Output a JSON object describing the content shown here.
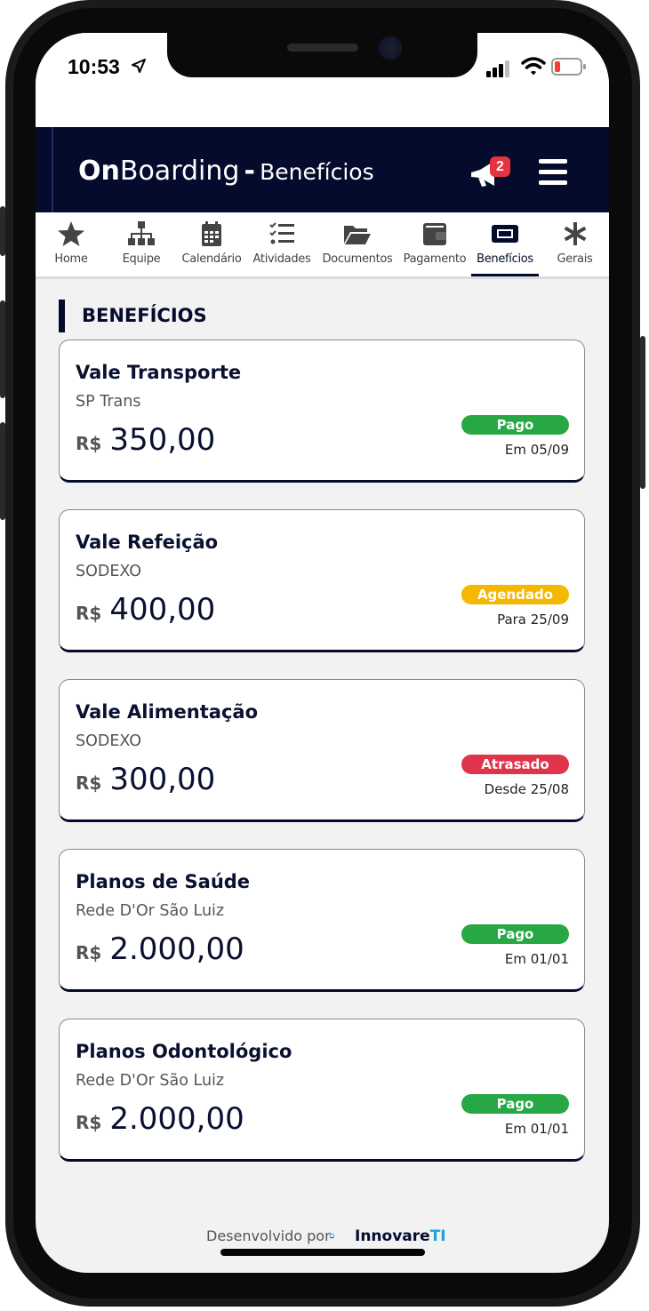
{
  "status_bar": {
    "time": "10:53"
  },
  "header": {
    "brand_bold": "On",
    "brand_rest": "Boarding",
    "separator": "-",
    "page": "Benefícios",
    "notification_count": "2"
  },
  "tabs": [
    {
      "label": "Home",
      "icon": "star-icon"
    },
    {
      "label": "Equipe",
      "icon": "sitemap-icon"
    },
    {
      "label": "Calendário",
      "icon": "calendar-icon"
    },
    {
      "label": "Atividades",
      "icon": "tasks-icon"
    },
    {
      "label": "Documentos",
      "icon": "folder-open-icon"
    },
    {
      "label": "Pagamento",
      "icon": "wallet-icon"
    },
    {
      "label": "Benefícios",
      "icon": "ticket-icon",
      "active": true
    },
    {
      "label": "Gerais",
      "icon": "asterisk-icon"
    }
  ],
  "section": {
    "title": "BENEFÍCIOS"
  },
  "benefits": [
    {
      "name": "Vale Transporte",
      "provider": "SP Trans",
      "currency": "R$",
      "amount": "350,00",
      "status": "Pago",
      "status_color": "#28a745",
      "date": "Em 05/09"
    },
    {
      "name": "Vale Refeição",
      "provider": "SODEXO",
      "currency": "R$",
      "amount": "400,00",
      "status": "Agendado",
      "status_color": "#f5b800",
      "date": "Para 25/09"
    },
    {
      "name": "Vale Alimentação",
      "provider": "SODEXO",
      "currency": "R$",
      "amount": "300,00",
      "status": "Atrasado",
      "status_color": "#e0344a",
      "date": "Desde 25/08"
    },
    {
      "name": "Planos de Saúde",
      "provider": "Rede D'Or São Luiz",
      "currency": "R$",
      "amount": "2.000,00",
      "status": "Pago",
      "status_color": "#28a745",
      "date": "Em 01/01"
    },
    {
      "name": "Planos Odontológico",
      "provider": "Rede D'Or São Luiz",
      "currency": "R$",
      "amount": "2.000,00",
      "status": "Pago",
      "status_color": "#28a745",
      "date": "Em 01/01"
    }
  ],
  "footer": {
    "text": "Desenvolvido por",
    "brand": "Innovare",
    "brand_suffix": "TI"
  },
  "colors": {
    "navy": "#040b2c",
    "pago": "#28a745",
    "agendado": "#f5b800",
    "atrasado": "#e0344a"
  }
}
